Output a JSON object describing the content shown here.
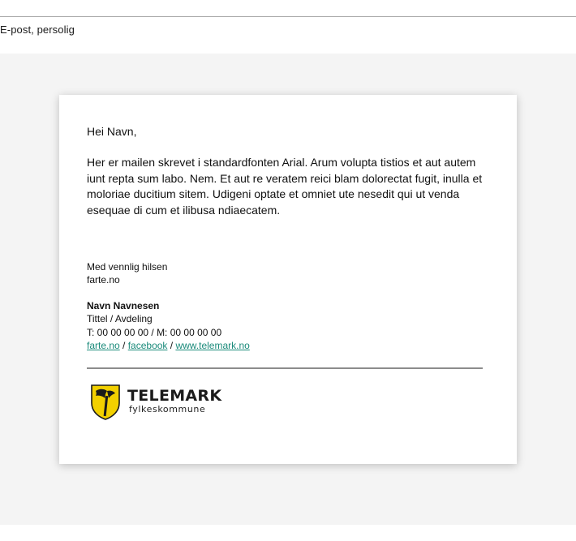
{
  "header": {
    "section_label": "E-post, persolig"
  },
  "email": {
    "greeting": "Hei Navn,",
    "body": "Her er mailen skrevet i standardfonten Arial. Arum volupta tistios et aut autem iunt repta sum labo. Nem. Et aut re veratem reici blam dolorectat fugit, inulla et moloriae ducitium sitem. Udigeni optate et omniet ute nesedit qui ut venda esequae di cum et ilibusa ndiaecatem.",
    "signoff_line1": "Med vennlig hilsen",
    "signoff_line2": "farte.no",
    "signature": {
      "name": "Navn Navnesen",
      "title": "Tittel / Avdeling",
      "phone": "T: 00 00 00 00 / M: 00 00 00 00",
      "links": {
        "link1": "farte.no",
        "sep1": " / ",
        "link2": "facebook",
        "sep2": " / ",
        "link3": "www.telemark.no"
      }
    },
    "logo": {
      "icon": "telemark-shield-icon",
      "name": "TELEMARK",
      "subtitle": "fylkeskommune",
      "shield_color": "#f2d000",
      "shield_outline": "#1a1a1a"
    },
    "link_color": "#1a8a7a"
  }
}
